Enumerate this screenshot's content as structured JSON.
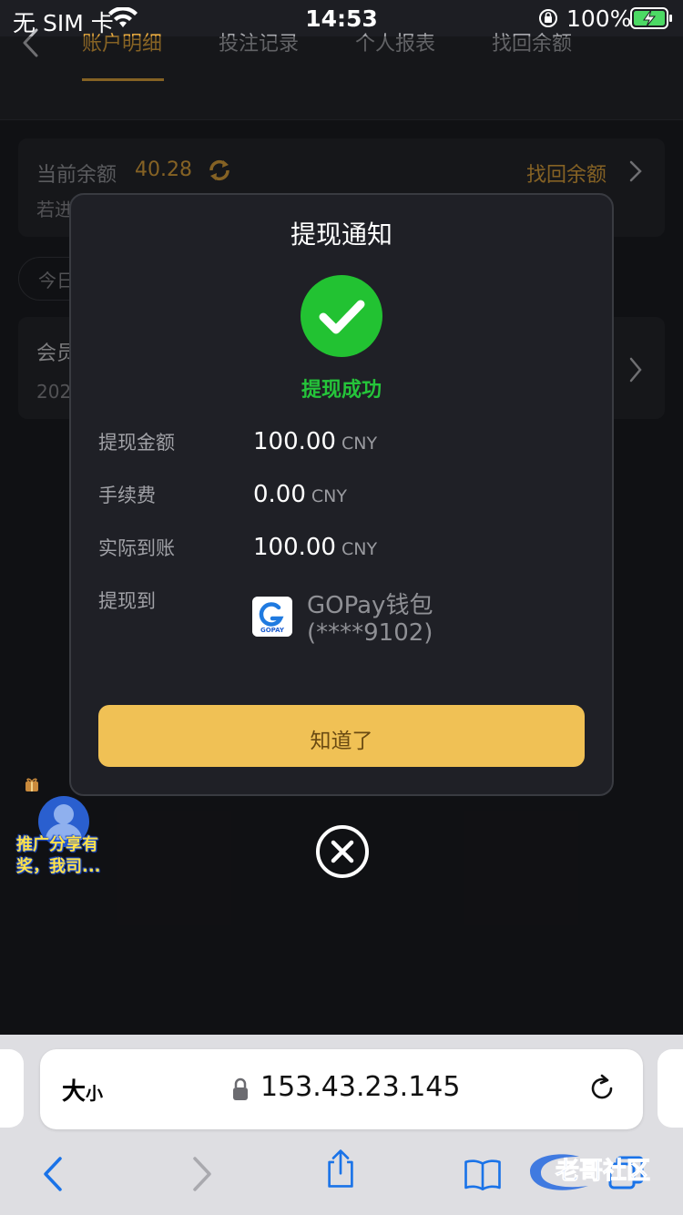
{
  "status_bar": {
    "carrier": "无 SIM 卡",
    "time": "14:53",
    "battery": "100%"
  },
  "nav": {
    "tabs": [
      {
        "label": "账户明细",
        "active": true
      },
      {
        "label": "投注记录",
        "active": false
      },
      {
        "label": "个人报表",
        "active": false
      },
      {
        "label": "找回余额",
        "active": false
      }
    ]
  },
  "background": {
    "balance_label": "当前余额",
    "balance_value": "40.28",
    "recover_link": "找回余额",
    "hint_text": "若进",
    "date_filter": "今日",
    "record_title": "会员",
    "record_date": "202"
  },
  "promo": {
    "text": "推广分享有奖，我司..."
  },
  "modal": {
    "title": "提现通知",
    "status": "提现成功",
    "rows": [
      {
        "label": "提现金额",
        "value": "100.00",
        "unit": "CNY"
      },
      {
        "label": "手续费",
        "value": "0.00",
        "unit": "CNY"
      },
      {
        "label": "实际到账",
        "value": "100.00",
        "unit": "CNY"
      },
      {
        "label": "提现到",
        "wallet_name": "GOPay钱包",
        "wallet_account": "(****9102)",
        "wallet_logo_text": "GOPAY"
      }
    ],
    "confirm_label": "知道了"
  },
  "browser": {
    "text_size_label": "大",
    "text_size_small": "小",
    "url": "153.43.23.145",
    "watermark_text": "老哥社区"
  },
  "colors": {
    "accent": "#e6a93f",
    "success": "#25c43a",
    "button": "#f0c155"
  },
  "icons": [
    "wifi-icon",
    "rotation-lock-icon",
    "battery-charging-icon",
    "back-chevron-icon",
    "refresh-icon",
    "chevron-right-icon",
    "check-icon",
    "close-icon",
    "lock-icon",
    "reload-icon",
    "share-icon",
    "bookmarks-icon",
    "tabs-icon"
  ]
}
